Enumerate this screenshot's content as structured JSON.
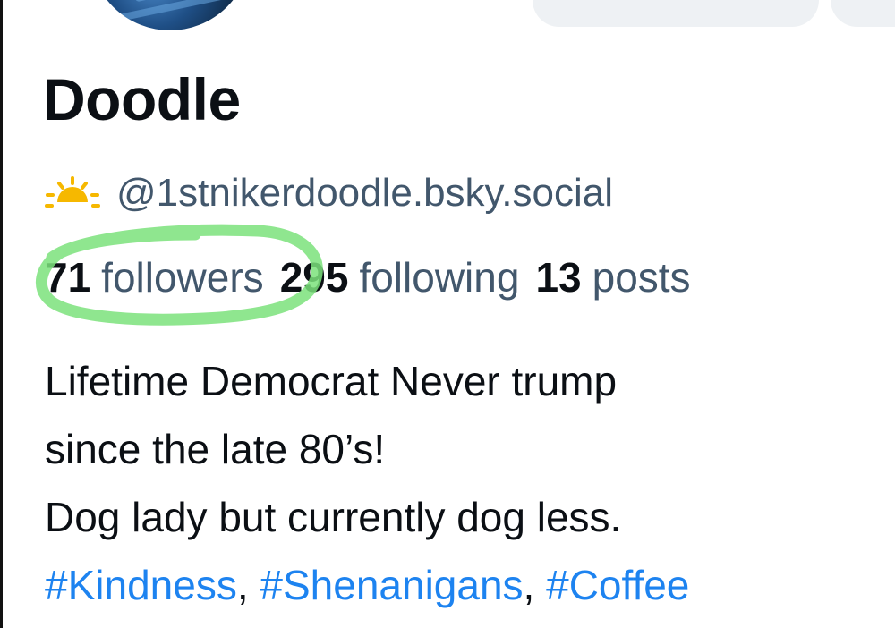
{
  "profile": {
    "display_name": "Doodle",
    "handle_icon": "sun-icon",
    "handle": "@1stnikerdoodle.bsky.social",
    "stats": [
      {
        "value": "71",
        "label": "followers"
      },
      {
        "value": "295",
        "label": "following"
      },
      {
        "value": "13",
        "label": "posts"
      }
    ],
    "bio_lines": [
      "Lifetime Democrat Never trump",
      "since the late 80’s!",
      "Dog lady but currently dog less."
    ],
    "hashtags": [
      "#Kindness",
      "#Shenanigans",
      "#Coffee"
    ],
    "hashtag_separator": ", "
  },
  "colors": {
    "text": "#0b0f14",
    "muted": "#42576c",
    "link": "#1d83f0",
    "highlight": "#7be27b"
  }
}
